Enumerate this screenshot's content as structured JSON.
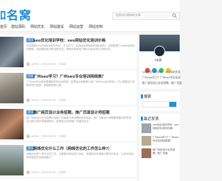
{
  "header": {
    "logo": "ﾛ名窝",
    "search_placeholder": "搜索站内最新的文章"
  },
  "nav": [
    "首页",
    "建站源码",
    "网站优化",
    "网站建设",
    "网站运营",
    "网站定制"
  ],
  "posts": [
    {
      "category": "资讯",
      "title": "seo优化培训学校：seo网站优化培训价格",
      "excerpt": "在这里是seo优化培训学校专区，可以学习、实战优化等相关的培训资料。这里整理了seo优化相关的教程，包括基础知识和进阶内容，帮助你更好地了解seo优化的方法和技巧。",
      "meta": "admin · 2024-06-18 · 4 阅读"
    },
    {
      "category": "问答",
      "title": "广州seo学习？广州seo专业培训网络推？",
      "excerpt": "广州seo专业培训是哪家机构比较好呢？这里给大家推荐几家广州的seo培训机构，可以根据自己的需求进行选择，希望能帮到大家。",
      "meta": "admin · 2024-06-18 · 3 阅读"
    },
    {
      "category": "资讯",
      "title": "推广网页设计业务招聘，推广页面设计师招聘",
      "excerpt": "推广网页设计业务招聘以及推广页面设计师招聘的相关信息。推广页面设计师需要具备创意思维、设计能力和市场营销知识，能够独立完成推广页面的设计。",
      "meta": "admin · 2024-06-18 · 5 阅读"
    },
    {
      "category": "资讯",
      "title": "网络优化什么工作（网络优化的工作怎么样?）",
      "excerpt": "网络优化是一项专业的工作，主要是对网站进行优化，提高网站在搜索引擎中的排名，从而为网站带来更多的流量和客户。",
      "meta": "admin · 2024-06-18 · 4 阅读"
    }
  ],
  "sidebar": {
    "profile_name": "ﾛ名窝",
    "site_links": [
      "seo优化培训学校：seo网站优化",
      "广州seo学习？广州seo专业培训",
      "推广网页设计业务招聘，推广页面"
    ],
    "search_heading": "搜索",
    "recent_heading": "最近发表",
    "recent_posts": [
      "seo优化培训学校：seo网站优化培训价格",
      "广州seo学习？广州seo专业培训网络推？",
      "推广网页设计业务招聘，推广页面"
    ]
  },
  "colors": {
    "accent": "#1e8fd8",
    "badge": "#4a90d9"
  }
}
